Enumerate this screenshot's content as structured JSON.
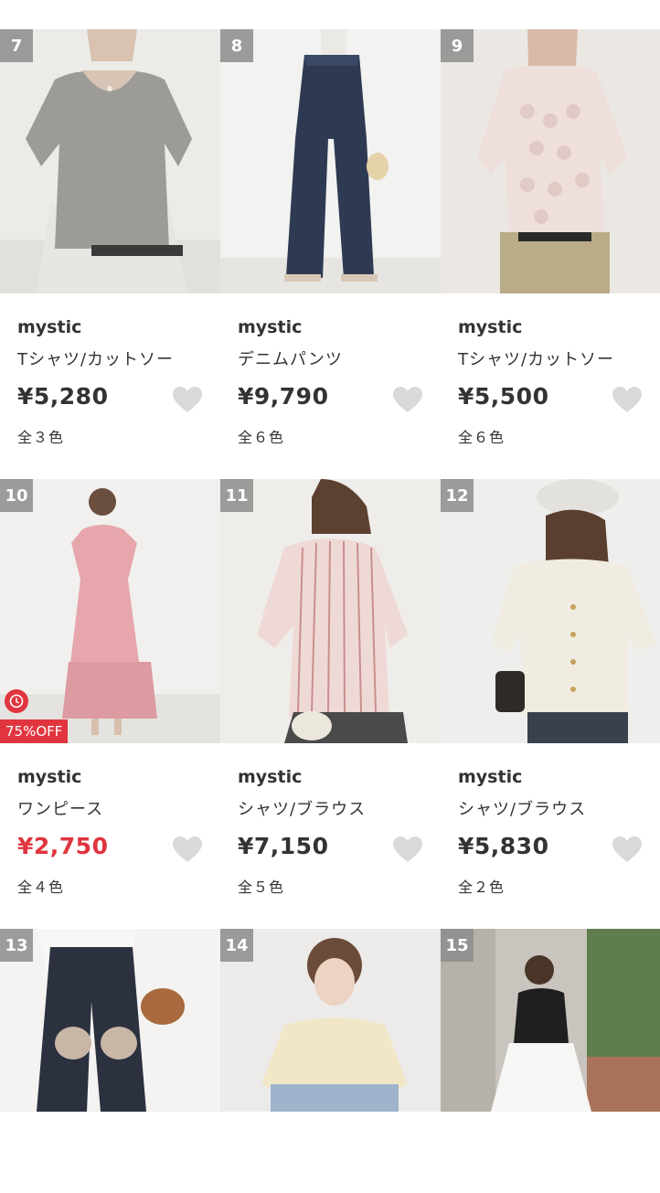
{
  "colors": {
    "sale": "#e0353f",
    "text": "#333333",
    "rank_badge": "#8c8c8c",
    "heart": "#d9d9d9"
  },
  "products": [
    {
      "rank": "7",
      "brand": "mystic",
      "category": "Tシャツ/カットソー",
      "price": "¥5,280",
      "colors": "全３色",
      "sale": false
    },
    {
      "rank": "8",
      "brand": "mystic",
      "category": "デニムパンツ",
      "price": "¥9,790",
      "colors": "全６色",
      "sale": false
    },
    {
      "rank": "9",
      "brand": "mystic",
      "category": "Tシャツ/カットソー",
      "price": "¥5,500",
      "colors": "全６色",
      "sale": false
    },
    {
      "rank": "10",
      "brand": "mystic",
      "category": "ワンピース",
      "price": "¥2,750",
      "colors": "全４色",
      "sale": true,
      "discount": "75%OFF",
      "badge_icon": "clock-icon"
    },
    {
      "rank": "11",
      "brand": "mystic",
      "category": "シャツ/ブラウス",
      "price": "¥7,150",
      "colors": "全５色",
      "sale": false
    },
    {
      "rank": "12",
      "brand": "mystic",
      "category": "シャツ/ブラウス",
      "price": "¥5,830",
      "colors": "全２色",
      "sale": false
    },
    {
      "rank": "13"
    },
    {
      "rank": "14"
    },
    {
      "rank": "15"
    }
  ]
}
